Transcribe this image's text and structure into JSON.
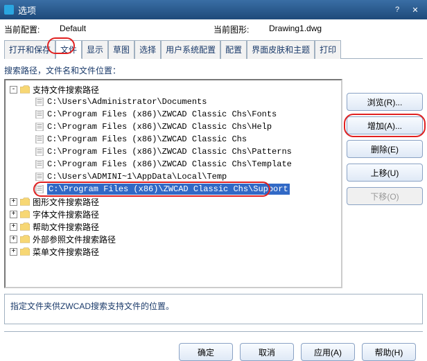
{
  "titlebar": {
    "title": "选项"
  },
  "info": {
    "config_label": "当前配置:",
    "config_value": "Default",
    "drawing_label": "当前图形:",
    "drawing_value": "Drawing1.dwg"
  },
  "tabs": [
    "打开和保存",
    "文件",
    "显示",
    "草图",
    "选择",
    "用户系统配置",
    "配置",
    "界面皮肤和主题",
    "打印"
  ],
  "section_label": "搜索路径，文件名和文件位置：",
  "tree": {
    "root": "支持文件搜索路径",
    "paths": [
      "C:\\Users\\Administrator\\Documents",
      "C:\\Program Files (x86)\\ZWCAD Classic Chs\\Fonts",
      "C:\\Program Files (x86)\\ZWCAD Classic Chs\\Help",
      "C:\\Program Files (x86)\\ZWCAD Classic Chs",
      "C:\\Program Files (x86)\\ZWCAD Classic Chs\\Patterns",
      "C:\\Program Files (x86)\\ZWCAD Classic Chs\\Template",
      "C:\\Users\\ADMINI~1\\AppData\\Local\\Temp",
      "C:\\Program Files (x86)\\ZWCAD Classic Chs\\Support"
    ],
    "siblings": [
      "图形文件搜索路径",
      "字体文件搜索路径",
      "帮助文件搜索路径",
      "外部参照文件搜索路径",
      "菜单文件搜索路径"
    ]
  },
  "side_buttons": {
    "browse": "浏览(R)...",
    "add": "增加(A)...",
    "remove": "删除(E)",
    "up": "上移(U)",
    "down": "下移(O)"
  },
  "desc": "指定文件夹供ZWCAD搜索支持文件的位置。",
  "footer": {
    "ok": "确定",
    "cancel": "取消",
    "apply": "应用(A)",
    "help": "帮助(H)"
  }
}
